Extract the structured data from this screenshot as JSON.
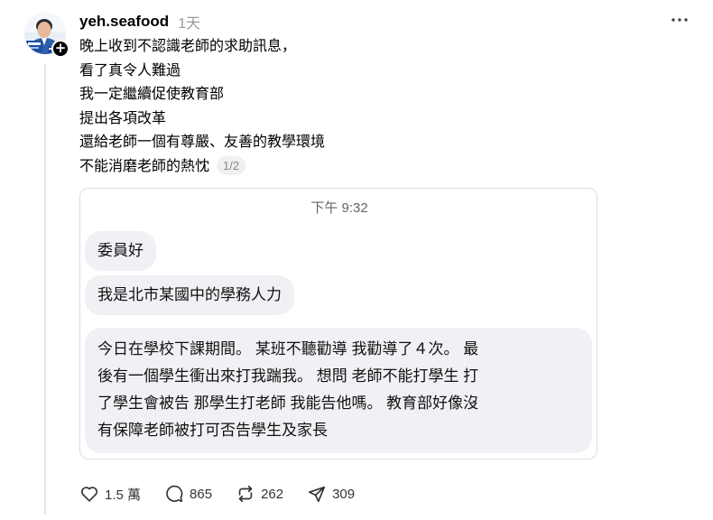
{
  "post": {
    "username": "yeh.seafood",
    "time": "1天",
    "lines": [
      "晚上收到不認識老師的求助訊息，",
      "看了真令人難過",
      "我一定繼續促使教育部",
      "提出各項改革",
      "還給老師一個有尊嚴、友善的教學環境",
      "不能消磨老師的熱忱"
    ],
    "page_indicator": "1/2"
  },
  "screenshot": {
    "time": "下午 9:32",
    "messages": [
      "委員好",
      "我是北市某國中的學務人力",
      "今日在學校下課期間。 某班不聽勸導 我勸導了４次。 最\n後有一個學生衝出來打我踹我。 想問 老師不能打學生 打\n了學生會被告 那學生打老師 我能告他嗎。 教育部好像沒\n有保障老師被打可否告學生及家長"
    ]
  },
  "actions": {
    "likes": "1.5 萬",
    "comments": "865",
    "reposts": "262",
    "shares": "309"
  },
  "icons": {
    "avatar": "profile-photo",
    "follow": "plus-icon",
    "more": "more-icon",
    "like": "heart-icon",
    "comment": "comment-icon",
    "repost": "repost-icon",
    "share": "send-icon"
  },
  "colors": {
    "bubble": "#f1f1f5",
    "muted": "#999999",
    "thread_line": "#e4e4e4"
  }
}
